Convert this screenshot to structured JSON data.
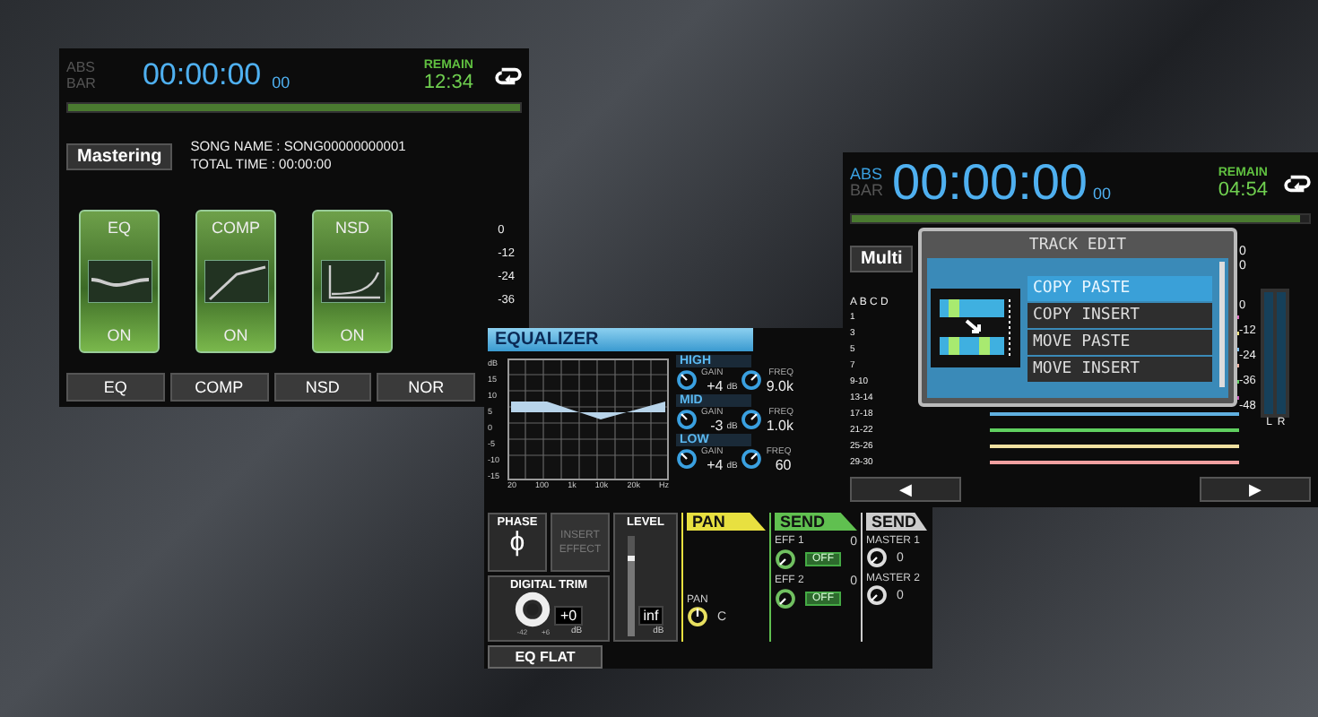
{
  "mastering_screen": {
    "abs": "ABS",
    "bar": "BAR",
    "time": "00:00:00",
    "frames": "00",
    "remain_label": "REMAIN",
    "remain": "12:34",
    "progress": {
      "level": 1
    },
    "mode": "Mastering",
    "song_name": "SONG NAME : SONG00000000001",
    "total_time": "TOTAL TIME : 00:00:00",
    "modules": [
      {
        "kind": "eq",
        "label": "EQ",
        "state": "ON",
        "on": true
      },
      {
        "kind": "comp",
        "label": "COMP",
        "state": "ON",
        "on": true
      },
      {
        "kind": "nsd",
        "label": "NSD",
        "state": "ON",
        "on": true
      }
    ],
    "meter_scale": [
      "0",
      "-12",
      "-24",
      "-36"
    ],
    "buttons": [
      "EQ",
      "COMP",
      "NSD",
      "NOR"
    ]
  },
  "equalizer": {
    "title": "EQUALIZER",
    "y_labels": [
      "dB",
      "15",
      "10",
      "5",
      "0",
      "-5",
      "-10",
      "-15"
    ],
    "x_labels": [
      "20",
      "100",
      "1k",
      "10k",
      "20k"
    ],
    "x_unit": "Hz",
    "bands": [
      {
        "name": "HIGH",
        "gain_label": "GAIN",
        "gain": "+4",
        "gain_unit": "dB",
        "freq_label": "FREQ",
        "freq": "9.0k"
      },
      {
        "name": "MID",
        "gain_label": "GAIN",
        "gain": "-3",
        "gain_unit": "dB",
        "freq_label": "FREQ",
        "freq": "1.0k"
      },
      {
        "name": "LOW",
        "gain_label": "GAIN",
        "gain": "+4",
        "gain_unit": "dB",
        "freq_label": "FREQ",
        "freq": "60"
      }
    ],
    "phase": {
      "label": "PHASE",
      "symbol": "ϕ"
    },
    "insert_effect": {
      "label": "INSERT EFFECT",
      "disabled": true
    },
    "level": {
      "label": "LEVEL",
      "value": "inf",
      "unit": "dB",
      "level": 0.8
    },
    "digital_trim": {
      "label": "DIGITAL TRIM",
      "value": "+0",
      "unit": "dB",
      "min": "-42",
      "max": "+6"
    },
    "eq_flat": "EQ FLAT",
    "pan": {
      "title": "PAN",
      "label": "PAN",
      "value": "C"
    },
    "send_effects": {
      "title": "SEND",
      "sends": [
        {
          "label": "EFF 1",
          "value": "0",
          "button": "OFF"
        },
        {
          "label": "EFF 2",
          "value": "0",
          "button": "OFF"
        }
      ]
    },
    "send_masters": {
      "title": "SEND",
      "sends": [
        {
          "label": "MASTER 1",
          "value": "0"
        },
        {
          "label": "MASTER 2",
          "value": "0"
        }
      ]
    }
  },
  "track_screen": {
    "abs": "ABS",
    "bar": "BAR",
    "time": "00:00:00",
    "frames": "00",
    "remain_label": "REMAIN",
    "remain": "04:54",
    "progress": {
      "level": 0.98
    },
    "mode": "Multi",
    "channel_letters": "A B C D",
    "tracks": [
      {
        "label": "1",
        "color": "#e070c0"
      },
      {
        "label": "3",
        "color": "#f0e080"
      },
      {
        "label": "5",
        "color": "#80c0f0"
      },
      {
        "label": "7",
        "color": "#f0b0a0"
      },
      {
        "label": "9-10",
        "color": "#60d060"
      },
      {
        "label": "13-14",
        "color": "#d060c0"
      },
      {
        "label": "17-18",
        "color": "#60b0e0"
      },
      {
        "label": "21-22",
        "color": "#60d060"
      },
      {
        "label": "25-26",
        "color": "#f0e0a0"
      },
      {
        "label": "29-30",
        "color": "#f0a0a0"
      }
    ],
    "right_values": [
      "0",
      "0"
    ],
    "meter_scale": [
      "0",
      "-12",
      "-24",
      "-36",
      "-48"
    ],
    "meter_labels": [
      "L",
      "R"
    ],
    "nav": [
      "◀",
      "▶"
    ],
    "dialog": {
      "title": "TRACK EDIT",
      "items": [
        {
          "label": "COPY PASTE",
          "selected": true
        },
        {
          "label": "COPY INSERT",
          "selected": false
        },
        {
          "label": "MOVE PASTE",
          "selected": false
        },
        {
          "label": "MOVE INSERT",
          "selected": false
        }
      ]
    }
  }
}
